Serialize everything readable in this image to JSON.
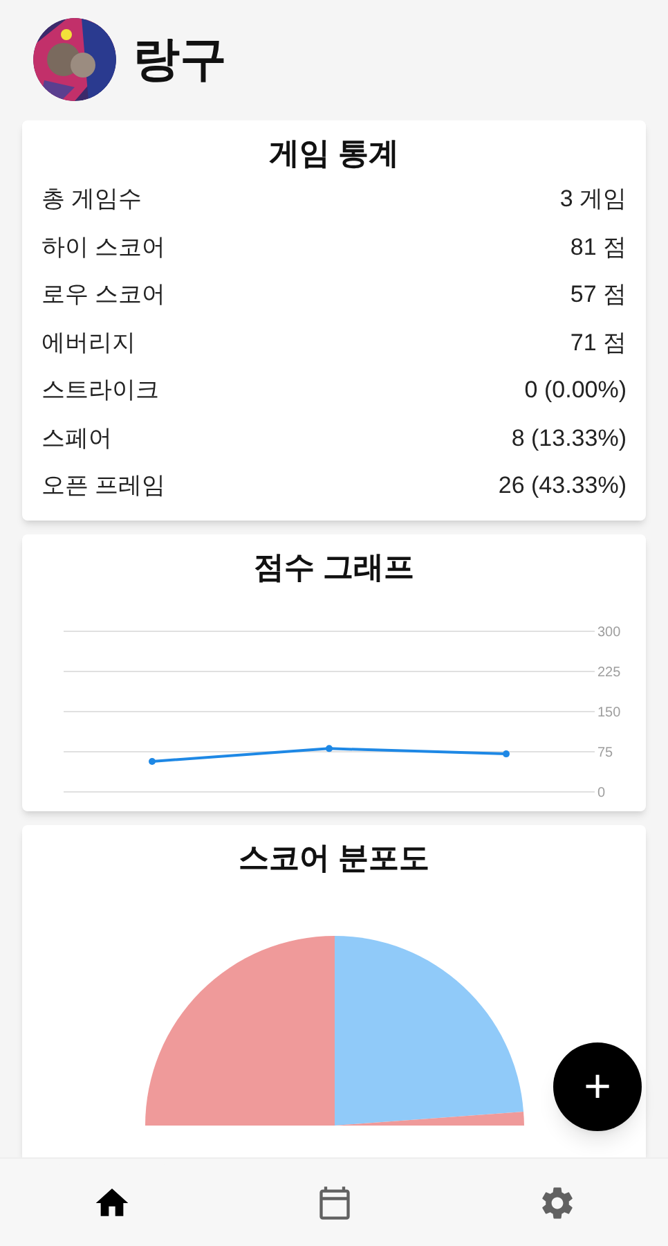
{
  "profile": {
    "name": "랑구"
  },
  "stats": {
    "title": "게임 통계",
    "rows": [
      {
        "label": "총 게임수",
        "value": "3 게임"
      },
      {
        "label": "하이 스코어",
        "value": "81 점"
      },
      {
        "label": "로우 스코어",
        "value": "57 점"
      },
      {
        "label": "에버리지",
        "value": "71 점"
      },
      {
        "label": "스트라이크",
        "value": "0 (0.00%)"
      },
      {
        "label": "스페어",
        "value": "8 (13.33%)"
      },
      {
        "label": "오픈 프레임",
        "value": "26 (43.33%)"
      }
    ]
  },
  "score_graph": {
    "title": "점수 그래프",
    "chart_data": {
      "type": "line",
      "categories": [
        null,
        null,
        null
      ],
      "ylim": [
        0,
        300
      ],
      "grid": true,
      "yticks": [
        0,
        75,
        150,
        225,
        300
      ],
      "series": [
        {
          "color": "#1e88e5",
          "marker": "circle",
          "values": [
            57,
            81,
            71
          ]
        }
      ]
    }
  },
  "distribution": {
    "title": "스코어 분포도"
  },
  "fab": {
    "label": "+"
  },
  "nav": [
    {
      "kind": "home",
      "selected": true
    },
    {
      "kind": "calendar",
      "selected": false
    },
    {
      "kind": "settings",
      "selected": false
    }
  ]
}
